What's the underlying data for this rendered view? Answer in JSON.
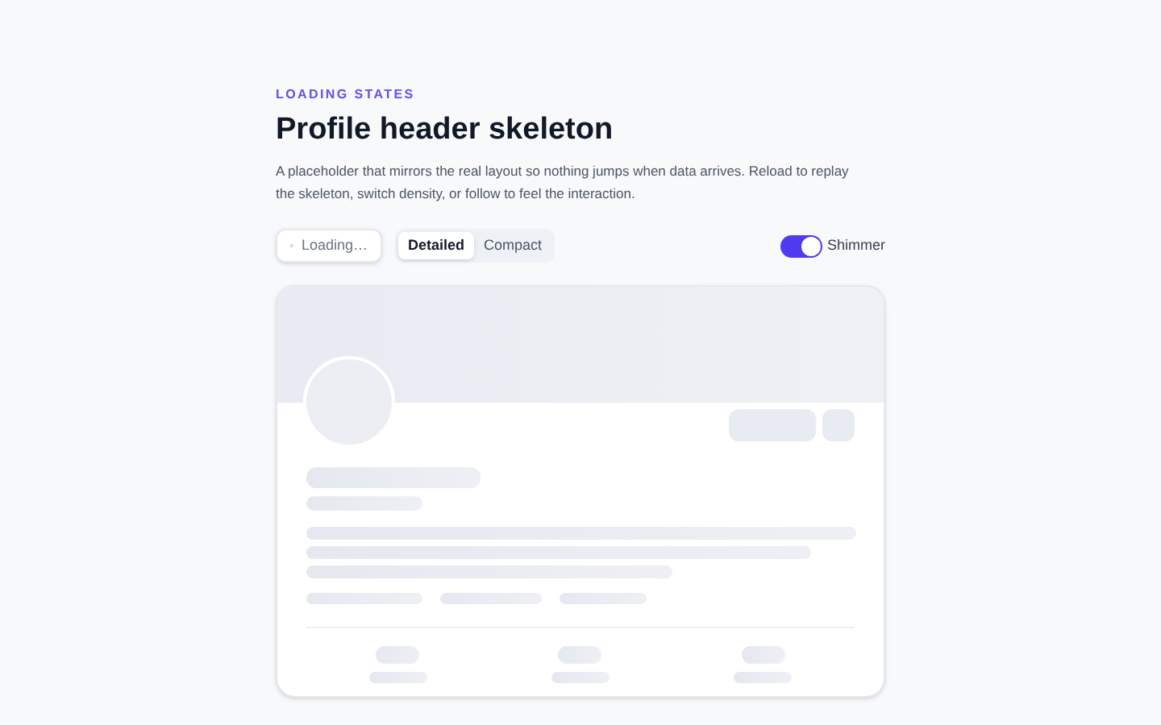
{
  "eyebrow": "LOADING STATES",
  "title": "Profile header skeleton",
  "description": "A placeholder that mirrors the real layout so nothing jumps when data arrives. Reload to replay the skeleton, switch density, or follow to feel the interaction.",
  "reload_button": {
    "label": "Loading…",
    "disabled": true
  },
  "density": [
    {
      "label": "Detailed",
      "selected": true
    },
    {
      "label": "Compact",
      "selected": false
    }
  ],
  "shimmer": {
    "label": "Shimmer",
    "on": true
  }
}
